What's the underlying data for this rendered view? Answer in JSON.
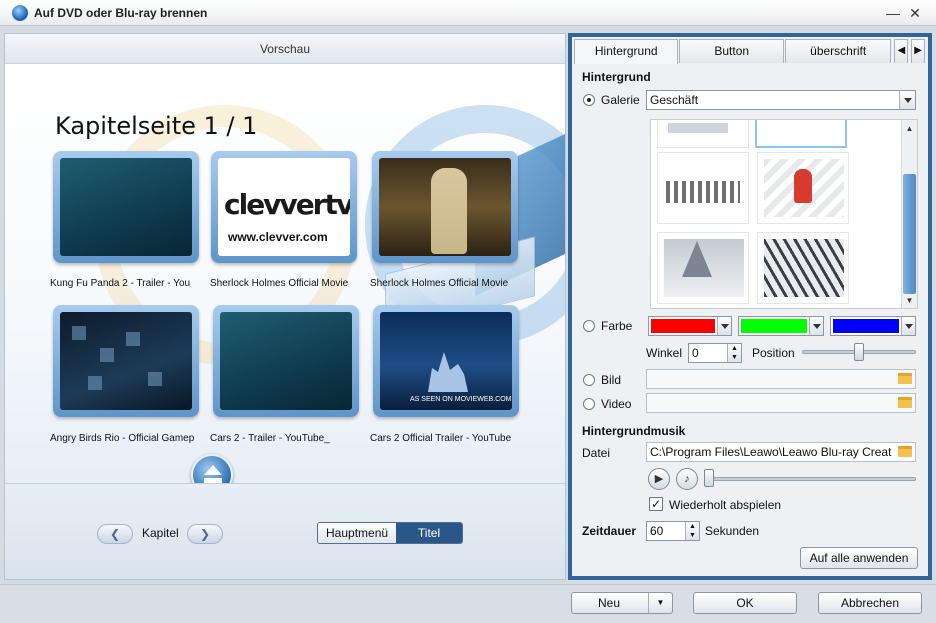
{
  "window": {
    "title": "Auf DVD oder Blu-ray brennen",
    "minimize_glyph": "—",
    "close_glyph": "✕"
  },
  "preview": {
    "header": "Vorschau",
    "page_heading": "Kapitelseite 1 / 1",
    "clevver_logo": "clevvertv",
    "clevver_url": "www.clevver.com",
    "castle_caption": "AS SEEN ON MOVIEWEB.COM",
    "thumbnails": [
      {
        "label": "Kung Fu Panda 2 - Trailer - You"
      },
      {
        "label": "Sherlock Holmes Official Movie"
      },
      {
        "label": "Sherlock Holmes Official Movie"
      },
      {
        "label": "Angry Birds Rio - Official Gamep"
      },
      {
        "label": "Cars 2 - Trailer - YouTube_"
      },
      {
        "label": "Cars 2 Official Trailer - YouTube"
      }
    ],
    "nav": {
      "prev_glyph": "❮",
      "next_glyph": "❯",
      "kapitel_label": "Kapitel",
      "hauptmenu": "Hauptmenü",
      "titel": "Titel"
    }
  },
  "settings": {
    "tabs": [
      "Hintergrund",
      "Button",
      "überschrift"
    ],
    "tab_prev_glyph": "◀",
    "tab_next_glyph": "▶",
    "hintergrund_title": "Hintergrund",
    "galerie_label": "Galerie",
    "galerie_value": "Geschäft",
    "farbe_label": "Farbe",
    "colors": [
      "#ff0000",
      "#00ff00",
      "#0000ff"
    ],
    "winkel_label": "Winkel",
    "winkel_value": "0",
    "position_label": "Position",
    "position_level": 0.5,
    "bild_label": "Bild",
    "video_label": "Video",
    "musik_title": "Hintergrundmusik",
    "datei_label": "Datei",
    "datei_value": "C:\\Program Files\\Leawo\\Leawo Blu-ray Creat",
    "play_glyph": "▶",
    "music_glyph": "♪",
    "repeat_label": "Wiederholt abspielen",
    "repeat_checked": true,
    "zeitdauer_label": "Zeitdauer",
    "zeitdauer_value": "60",
    "sekunden_label": "Sekunden",
    "apply_all": "Auf alle anwenden"
  },
  "footer": {
    "neu": "Neu",
    "ok": "OK",
    "abbrechen": "Abbrechen"
  }
}
